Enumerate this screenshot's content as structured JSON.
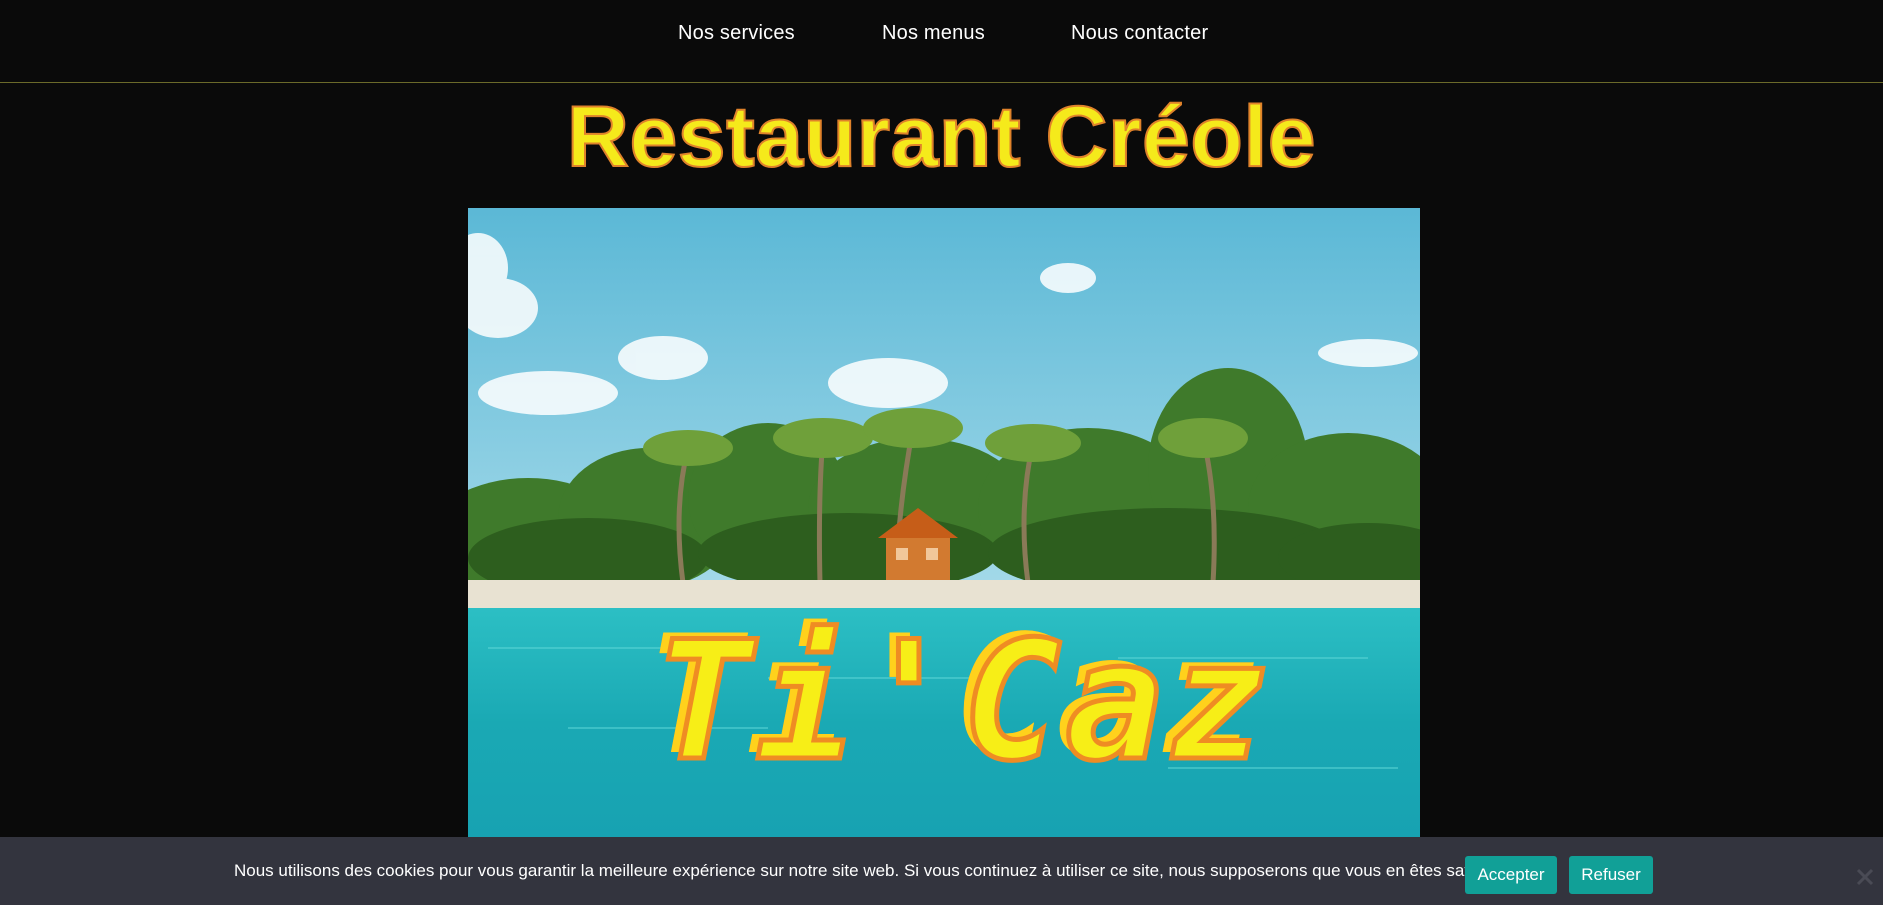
{
  "nav": {
    "items": [
      {
        "label": "Nos services"
      },
      {
        "label": "Nos menus"
      },
      {
        "label": "Nous contacter"
      }
    ]
  },
  "header": {
    "title": "Restaurant Créole"
  },
  "hero": {
    "logo_text": "Ti'Caz"
  },
  "cookie_banner": {
    "message": "Nous utilisons des cookies pour vous garantir la meilleure expérience sur notre site web. Si vous continuez à utiliser ce site, nous supposerons que vous en êtes satisfait.",
    "accept_label": "Accepter",
    "refuse_label": "Refuser",
    "close_icon": "close-icon"
  },
  "colors": {
    "background": "#0a0a0a",
    "title_fill": "#f5ea1b",
    "title_stroke": "#e0822a",
    "button": "#11a097",
    "banner": "#33343e"
  }
}
